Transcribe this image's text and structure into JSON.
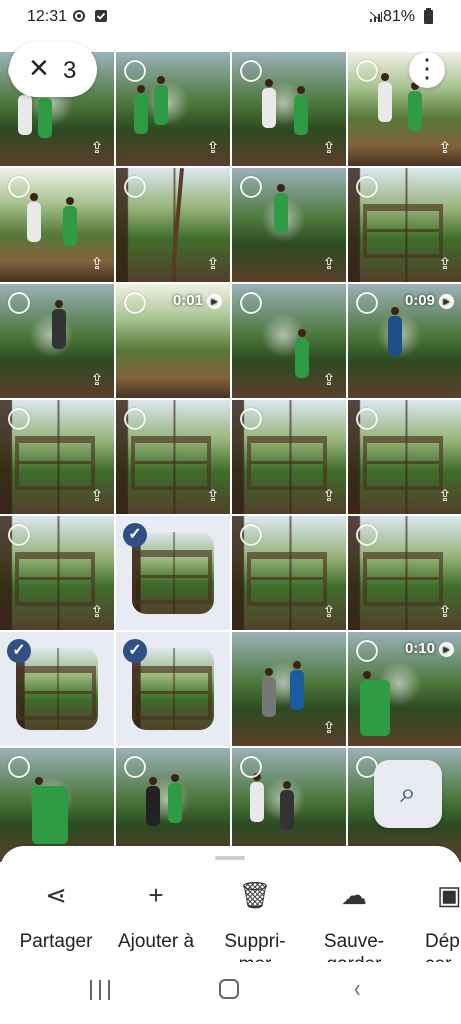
{
  "status": {
    "time": "12:31",
    "battery": "81%"
  },
  "selection": {
    "count": "3"
  },
  "grid": {
    "videos": [
      "0:01",
      "0:09",
      "0:10"
    ]
  },
  "actions": [
    {
      "label": "Partager",
      "icon": "share-icon"
    },
    {
      "label": "Ajouter à",
      "icon": "plus-icon"
    },
    {
      "label": "Suppri-\nmer",
      "icon": "trash-icon"
    },
    {
      "label": "Sauve-\ngarder",
      "icon": "cloud-upload-icon"
    },
    {
      "label": "Dép\ncer d\n\"Arch",
      "icon": "archive-icon"
    }
  ],
  "colors": {
    "selected": "#2f4f85",
    "selected_background": "#e8ebf3"
  }
}
